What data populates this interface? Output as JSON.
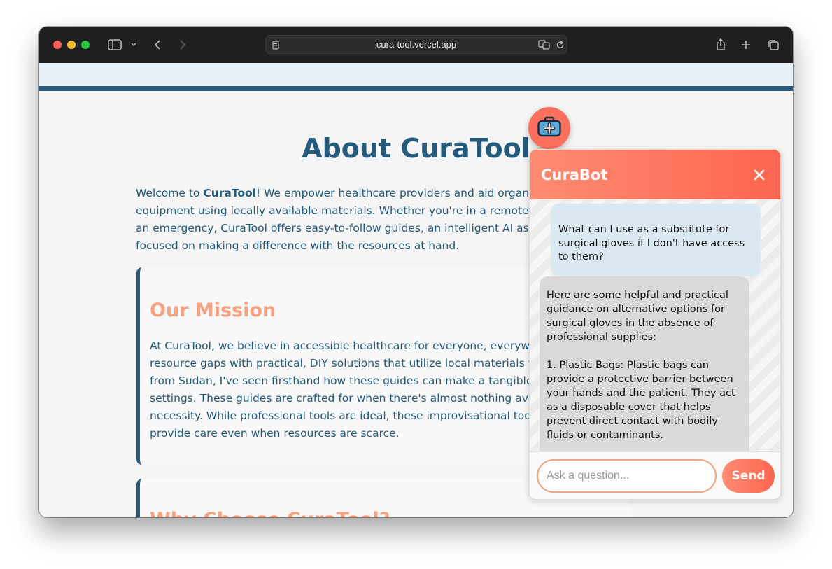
{
  "browser": {
    "url": "cura-tool.vercel.app",
    "traffic_lights": [
      "#fe5f57",
      "#febc2e",
      "#28c840"
    ]
  },
  "page": {
    "title": "About CuraTool",
    "intro": {
      "welcome_prefix": "Welcome to ",
      "brand": "CuraTool",
      "line1_rest": "! We empower healthcare providers and aid organization",
      "line2": "equipment using locally available materials. Whether you're in a remote area,",
      "line3": "an emergency, CuraTool offers easy-to-follow guides, an intelligent AI assistan",
      "line4": "focused on making a difference with the resources at hand."
    },
    "mission": {
      "heading": "Our Mission",
      "lines": [
        "At CuraTool, we believe in accessible healthcare for everyone, everywhere.",
        "resource gaps with practical, DIY solutions that utilize local materials wher",
        "from Sudan, I've seen firsthand how these guides can make a tangible diffe",
        "settings. These guides are crafted for when there's almost nothing availabl",
        "necessity. While professional tools are ideal, these improvisational tools er",
        "provide care even when resources are scarce."
      ]
    },
    "why": {
      "heading": "Why Choose CuraTool?"
    }
  },
  "colors": {
    "primary": "#245a7c",
    "accent": "#fd6550",
    "accent_light": "#f7a181"
  },
  "chatbot": {
    "fab_icon": "medical-kit-icon",
    "title": "CuraBot",
    "close_icon": "close-icon",
    "messages": [
      {
        "role": "user",
        "lines": [
          "What can I use as a substitute for",
          "surgical gloves if I don't have access",
          "to them?"
        ]
      },
      {
        "role": "bot",
        "lines": [
          "Here are some helpful and practical",
          "guidance on alternative options for",
          "surgical gloves in the absence of",
          "professional supplies:",
          "",
          "1. Plastic Bags: Plastic bags can",
          "provide a protective barrier between",
          "your hands and the patient. They act",
          "as a disposable cover that helps",
          "prevent direct contact with bodily",
          "fluids or contaminants."
        ]
      }
    ],
    "input_placeholder": "Ask a question...",
    "send_label": "Send"
  }
}
